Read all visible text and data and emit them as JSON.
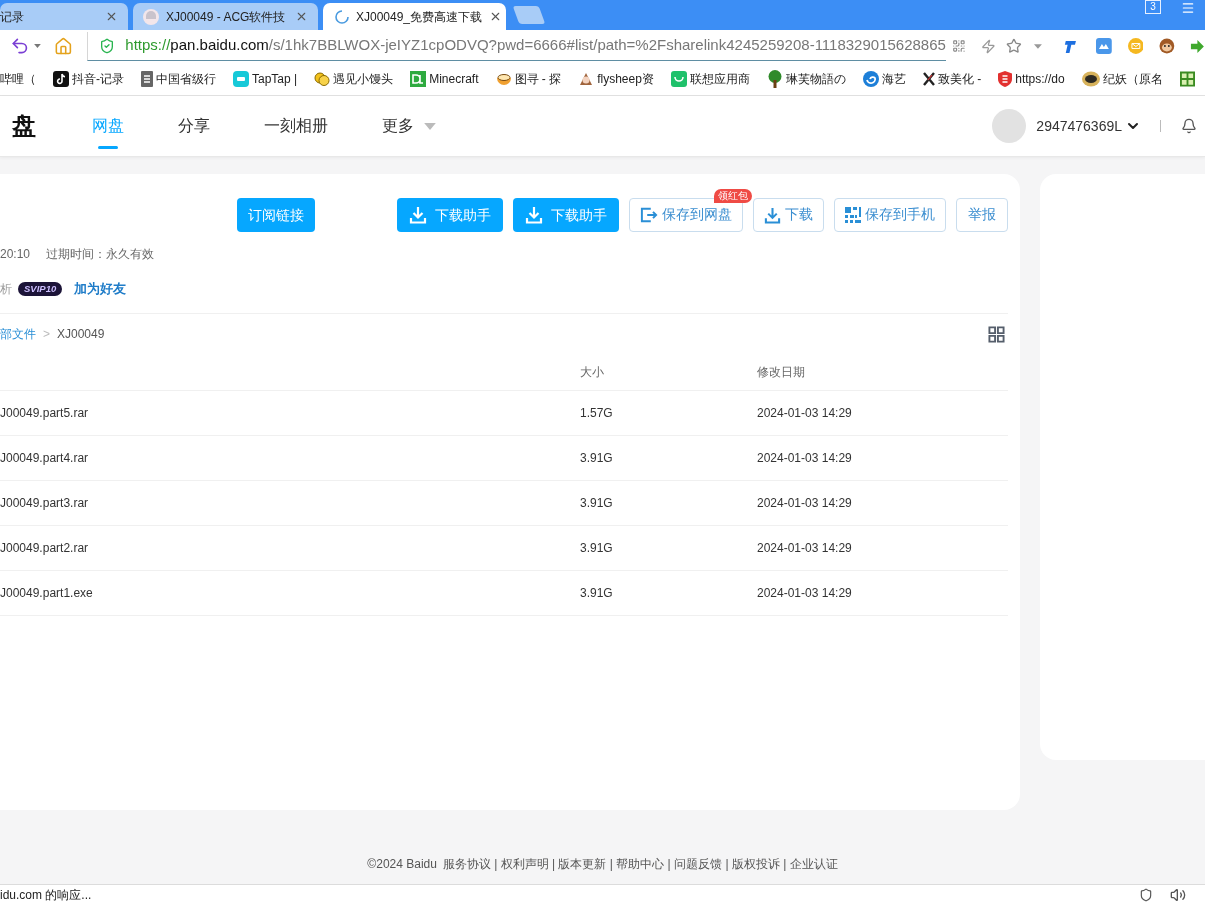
{
  "browser": {
    "tabs": [
      {
        "title": "记录",
        "selected": false,
        "loading": false
      },
      {
        "title": "XJ00049 - ACG软件技",
        "selected": false,
        "loading": false
      },
      {
        "title": "XJ00049_免费高速下载",
        "selected": true,
        "loading": true
      }
    ],
    "window_count": "3"
  },
  "address_bar": {
    "scheme": "https://",
    "host": "pan.baidu.com",
    "path": "/s/1hk7BBLWOX-jeIYZ1cpODVQ?pwd=6666#list/path=%2Fsharelink4245259208-1118329015628865"
  },
  "bookmarks": [
    "哔哩（",
    "抖音-记录",
    "中国省级行",
    "TapTap |",
    "遇见小馒头",
    "Minecraft",
    "图寻 - 探",
    "flysheep资",
    "联想应用商",
    "琳芙物語の",
    "海艺",
    "致美化 -",
    "https://do",
    "纪妖（原名"
  ],
  "header": {
    "logo": "盘",
    "nav": [
      {
        "label": "网盘",
        "selected": true,
        "dropdown": false
      },
      {
        "label": "分享",
        "selected": false,
        "dropdown": false
      },
      {
        "label": "一刻相册",
        "selected": false,
        "dropdown": false
      },
      {
        "label": "更多",
        "selected": false,
        "dropdown": true
      }
    ],
    "username": "2947476369L"
  },
  "share": {
    "actions": [
      {
        "label": "订阅链接",
        "kind": "subscribe"
      },
      {
        "label": "下载助手",
        "kind": "primary"
      },
      {
        "label": "下载助手",
        "kind": "primary"
      },
      {
        "label": "保存到网盘",
        "kind": "outline",
        "badge": "领红包"
      },
      {
        "label": "下载",
        "kind": "outline"
      },
      {
        "label": "保存到手机",
        "kind": "outline"
      },
      {
        "label": "举报",
        "kind": "outline"
      }
    ],
    "time": "20:10",
    "expiry": "过期时间：永久有效",
    "sharer": "析",
    "vip": "SVIP10",
    "add_friend": "加为好友"
  },
  "breadcrumb": {
    "items": [
      {
        "label": "部文件",
        "link": true
      },
      {
        "label": "XJ00049",
        "link": false
      }
    ],
    "separator": ">"
  },
  "table": {
    "columns": [
      "大小",
      "修改日期"
    ],
    "rows": [
      {
        "name": "J00049.part5.rar",
        "size": "1.57G",
        "modified": "2024-01-03 14:29"
      },
      {
        "name": "J00049.part4.rar",
        "size": "3.91G",
        "modified": "2024-01-03 14:29"
      },
      {
        "name": "J00049.part3.rar",
        "size": "3.91G",
        "modified": "2024-01-03 14:29"
      },
      {
        "name": "J00049.part2.rar",
        "size": "3.91G",
        "modified": "2024-01-03 14:29"
      },
      {
        "name": "J00049.part1.exe",
        "size": "3.91G",
        "modified": "2024-01-03 14:29"
      }
    ]
  },
  "footer": {
    "copyright": "©2024 Baidu",
    "links": "服务协议 | 权利声明 | 版本更新 | 帮助中心 | 问题反馈 | 版权投诉 | 企业认证"
  },
  "status_bar": {
    "text": "idu.com 的响应..."
  }
}
